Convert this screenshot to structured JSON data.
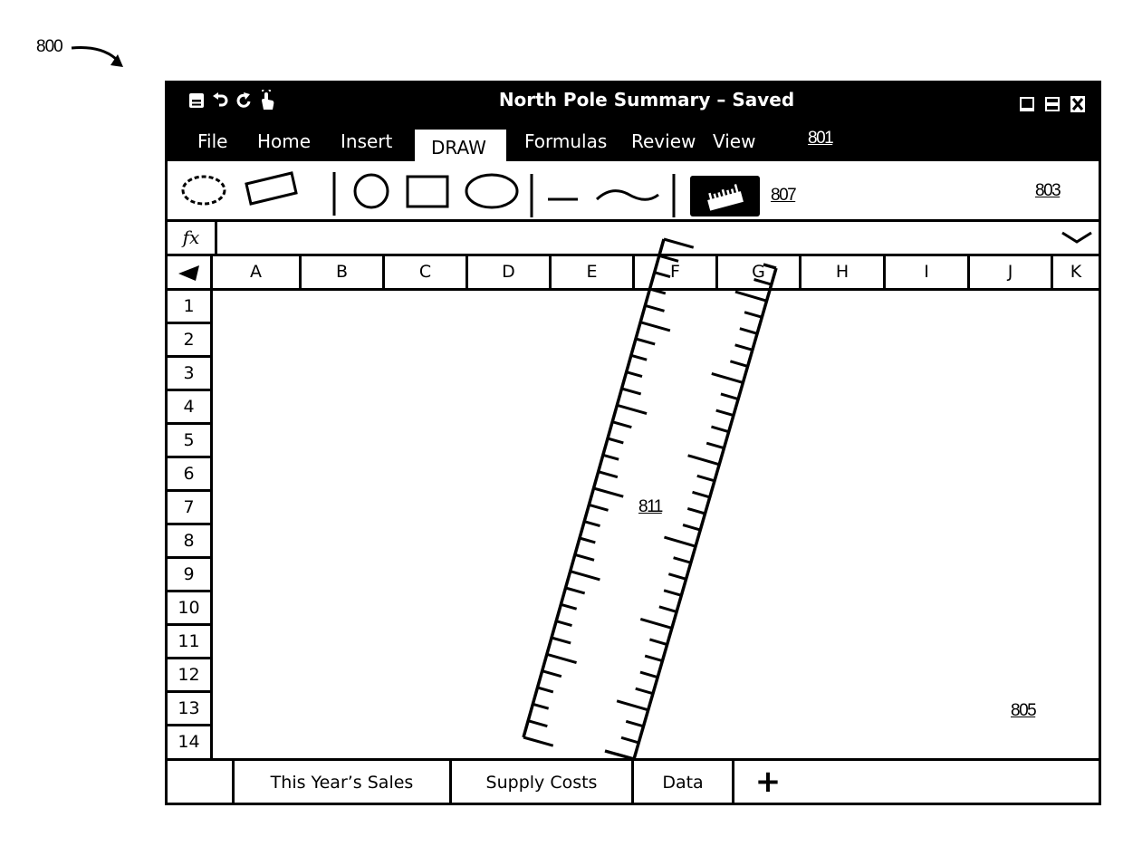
{
  "figure": {
    "ref_label": "800",
    "refs": {
      "menu": "801",
      "ribbon": "803",
      "ruler_tool": "807",
      "grid": "805",
      "ruler": "811"
    }
  },
  "window": {
    "title": "North Pole Summary – Saved",
    "quick_access": [
      "save-icon",
      "undo-icon",
      "redo-icon",
      "touch-mode-icon"
    ],
    "controls": [
      "minimize-icon",
      "maximize-icon",
      "close-icon"
    ]
  },
  "menu": {
    "tabs": [
      {
        "label": "File"
      },
      {
        "label": "Home"
      },
      {
        "label": "Insert"
      },
      {
        "label": "DRAW",
        "active": true
      },
      {
        "label": "Formulas"
      },
      {
        "label": "Review"
      },
      {
        "label": "View"
      }
    ]
  },
  "ribbon": {
    "tools": [
      "lasso-select-icon",
      "rotated-rectangle-icon",
      "circle-icon",
      "rectangle-icon",
      "ellipse-icon",
      "line-icon",
      "curve-icon",
      "ruler-icon"
    ],
    "selected_tool": "ruler-icon"
  },
  "formula_bar": {
    "label": "fx",
    "value": ""
  },
  "columns": [
    "A",
    "B",
    "C",
    "D",
    "E",
    "F",
    "G",
    "H",
    "I",
    "J",
    "K"
  ],
  "rows": [
    "1",
    "2",
    "3",
    "4",
    "5",
    "6",
    "7",
    "8",
    "9",
    "10",
    "11",
    "12",
    "13",
    "14"
  ],
  "sheet_tabs": [
    {
      "label": ""
    },
    {
      "label": "This Year’s Sales"
    },
    {
      "label": "Supply Costs"
    },
    {
      "label": "Data"
    }
  ],
  "add_sheet_label": "+"
}
